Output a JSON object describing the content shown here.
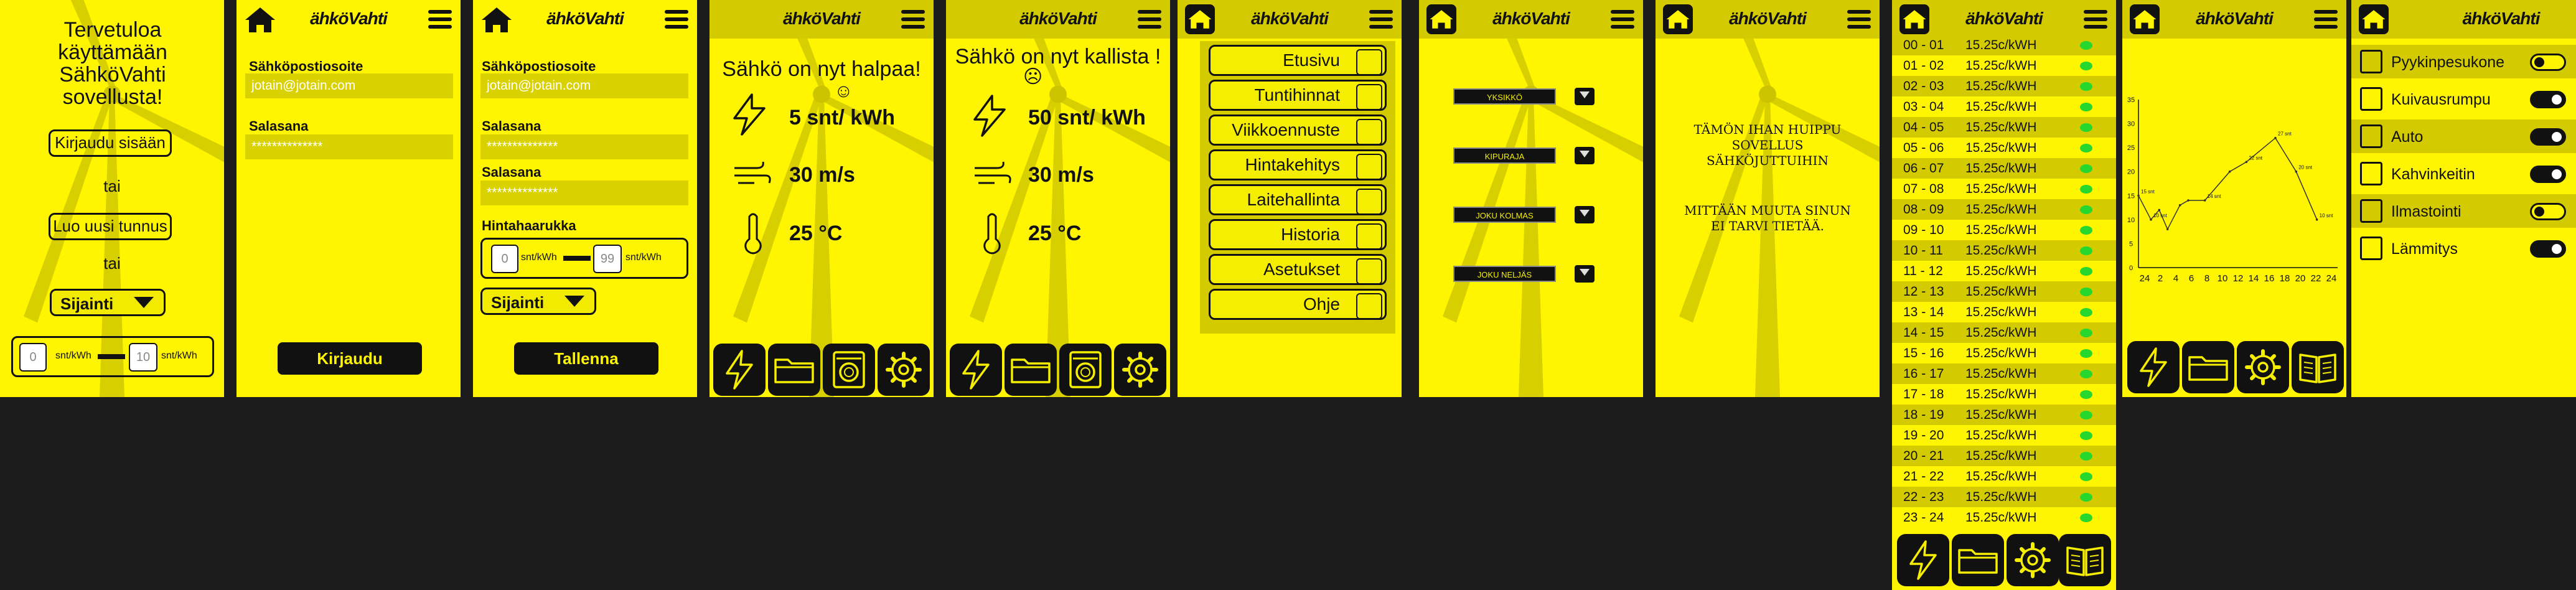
{
  "brand": {
    "logo_text": "ähköVahti",
    "accent": "#fff500",
    "dark_accent": "#d3cb00",
    "ok_color": "#26d82e"
  },
  "welcome": {
    "title": "Tervetuloa käyttämään SähköVahti sovellusta!",
    "login_button": "Kirjaudu sisään",
    "or1": "tai",
    "create_button": "Luo uusi tunnus",
    "or2": "tai",
    "location_select": "Sijainti",
    "range_min": "0",
    "range_max": "10",
    "unit1": "snt/kWh",
    "unit2": "snt/kWh"
  },
  "login": {
    "email_label": "Sähköpostiosoite",
    "email_value": "jotain@jotain.com",
    "password_label": "Salasana",
    "password_value": "**************",
    "submit": "Kirjaudu"
  },
  "register": {
    "email_label": "Sähköpostiosoite",
    "email_value": "jotain@jotain.com",
    "password_label": "Salasana",
    "password_value": "**************",
    "password2_label": "Salasana",
    "password2_value": "**************",
    "range_label": "Hintahaarukka",
    "range_min": "0",
    "range_max": "99",
    "unit1": "snt/kWh",
    "unit2": "snt/kWh",
    "location_select": "Sijainti",
    "submit": "Tallenna"
  },
  "cheap": {
    "headline": "Sähkö on nyt halpaa!",
    "price": "5 snt/ kWh",
    "wind": "30 m/s",
    "temp": "25 °C"
  },
  "expensive": {
    "headline": "Sähkö on nyt kallista !",
    "price": "50 snt/ kWh",
    "wind": "30 m/s",
    "temp": "25 °C"
  },
  "menu": {
    "items": [
      {
        "label": "Etusivu",
        "icon": "home-icon"
      },
      {
        "label": "Tuntihinnat",
        "icon": "bolt-icon"
      },
      {
        "label": "Viikkoennuste",
        "icon": "forecast-icon"
      },
      {
        "label": "Hintakehitys",
        "icon": "chart-icon"
      },
      {
        "label": "Laitehallinta",
        "icon": "appliance-icon"
      },
      {
        "label": "Historia",
        "icon": "folder-icon"
      },
      {
        "label": "Asetukset",
        "icon": "gear-icon"
      },
      {
        "label": "Ohje",
        "icon": "book-icon"
      }
    ]
  },
  "settings": {
    "items": [
      "YKSIKKÖ",
      "KIPURAJA",
      "JOKU KOLMAS",
      "JOKU NELJÄS"
    ]
  },
  "about": {
    "line1": "TÄMÖN IHAN HUIPPU SOVELLUS SÄHKÖJUTTUIHIN",
    "line2": "MITTÄÄN MUUTA SINUN EI TARVI TIETÄÄ."
  },
  "hourly": {
    "rows": [
      {
        "hour": "00 - 01",
        "price": "15.25c/kWH"
      },
      {
        "hour": "01 - 02",
        "price": "15.25c/kWH"
      },
      {
        "hour": "02 - 03",
        "price": "15.25c/kWH"
      },
      {
        "hour": "03 - 04",
        "price": "15.25c/kWH"
      },
      {
        "hour": "04 - 05",
        "price": "15.25c/kWH"
      },
      {
        "hour": "05 - 06",
        "price": "15.25c/kWH"
      },
      {
        "hour": "06 - 07",
        "price": "15.25c/kWH"
      },
      {
        "hour": "07 - 08",
        "price": "15.25c/kWH"
      },
      {
        "hour": "08 - 09",
        "price": "15.25c/kWH"
      },
      {
        "hour": "09 - 10",
        "price": "15.25c/kWH"
      },
      {
        "hour": "10 - 11",
        "price": "15.25c/kWH"
      },
      {
        "hour": "11 - 12",
        "price": "15.25c/kWH"
      },
      {
        "hour": "12 - 13",
        "price": "15.25c/kWH"
      },
      {
        "hour": "13 - 14",
        "price": "15.25c/kWH"
      },
      {
        "hour": "14 - 15",
        "price": "15.25c/kWH"
      },
      {
        "hour": "15 - 16",
        "price": "15.25c/kWH"
      },
      {
        "hour": "16 - 17",
        "price": "15.25c/kWH"
      },
      {
        "hour": "17 - 18",
        "price": "15.25c/kWH"
      },
      {
        "hour": "18 - 19",
        "price": "15.25c/kWH"
      },
      {
        "hour": "19 - 20",
        "price": "15.25c/kWH"
      },
      {
        "hour": "20 - 21",
        "price": "15.25c/kWH"
      },
      {
        "hour": "21 - 22",
        "price": "15.25c/kWH"
      },
      {
        "hour": "22 - 23",
        "price": "15.25c/kWH"
      },
      {
        "hour": "23 - 24",
        "price": "15.25c/kWH"
      }
    ]
  },
  "chart_data": {
    "type": "line",
    "x_ticks": [
      "24",
      "2",
      "4",
      "6",
      "8",
      "10",
      "12",
      "14",
      "16",
      "18",
      "20",
      "22",
      "24"
    ],
    "y_ticks": [
      "0",
      "5",
      "10",
      "15",
      "20",
      "25",
      "30",
      "35"
    ],
    "ylim": [
      0,
      35
    ],
    "x": [
      0,
      1.5,
      2.5,
      3.5,
      5,
      6,
      8,
      11,
      13,
      16.5,
      19,
      21.5
    ],
    "values": [
      15,
      10,
      12,
      8,
      13,
      14,
      14,
      20,
      22,
      27,
      20,
      10
    ],
    "labels": [
      "15 snt",
      "10 snt",
      "",
      "",
      "",
      "",
      "14 snt",
      "",
      "22 snt",
      "27 snt",
      "20 snt",
      "10 snt"
    ]
  },
  "devices": {
    "items": [
      {
        "name": "Pyykinpesukone",
        "icon": "washing-machine-icon",
        "on": false
      },
      {
        "name": "Kuivausrumpu",
        "icon": "dryer-icon",
        "on": true
      },
      {
        "name": "Auto",
        "icon": "car-icon",
        "on": true
      },
      {
        "name": "Kahvinkeitin",
        "icon": "coffee-maker-icon",
        "on": true
      },
      {
        "name": "Ilmastointi",
        "icon": "air-conditioner-icon",
        "on": false
      },
      {
        "name": "Lämmitys",
        "icon": "heater-icon",
        "on": true
      }
    ]
  }
}
